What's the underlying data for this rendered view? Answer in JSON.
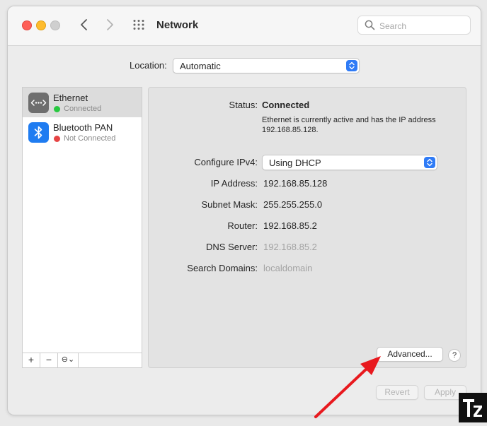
{
  "window": {
    "title": "Network"
  },
  "toolbar": {
    "search_placeholder": "Search"
  },
  "location": {
    "label": "Location:",
    "value": "Automatic"
  },
  "services": [
    {
      "name": "Ethernet",
      "status": "Connected",
      "status_color": "#28c840",
      "icon": "ethernet-icon"
    },
    {
      "name": "Bluetooth PAN",
      "status": "Not Connected",
      "status_color": "#e64444",
      "icon": "bluetooth-icon"
    }
  ],
  "sidebar_tools": {
    "add": "+",
    "remove": "−",
    "action": "⊖⌄"
  },
  "details": {
    "status_label": "Status:",
    "status_value": "Connected",
    "description": "Ethernet is currently active and has the IP address 192.168.85.128.",
    "configure_label": "Configure IPv4:",
    "configure_value": "Using DHCP",
    "ip_label": "IP Address:",
    "ip_value": "192.168.85.128",
    "subnet_label": "Subnet Mask:",
    "subnet_value": "255.255.255.0",
    "router_label": "Router:",
    "router_value": "192.168.85.2",
    "dns_label": "DNS Server:",
    "dns_value": "192.168.85.2",
    "search_domains_label": "Search Domains:",
    "search_domains_value": "localdomain"
  },
  "buttons": {
    "advanced": "Advanced...",
    "help": "?",
    "revert": "Revert",
    "apply": "Apply"
  },
  "colors": {
    "accent": "#2f7bf6",
    "annotation_arrow": "#e8191e"
  }
}
